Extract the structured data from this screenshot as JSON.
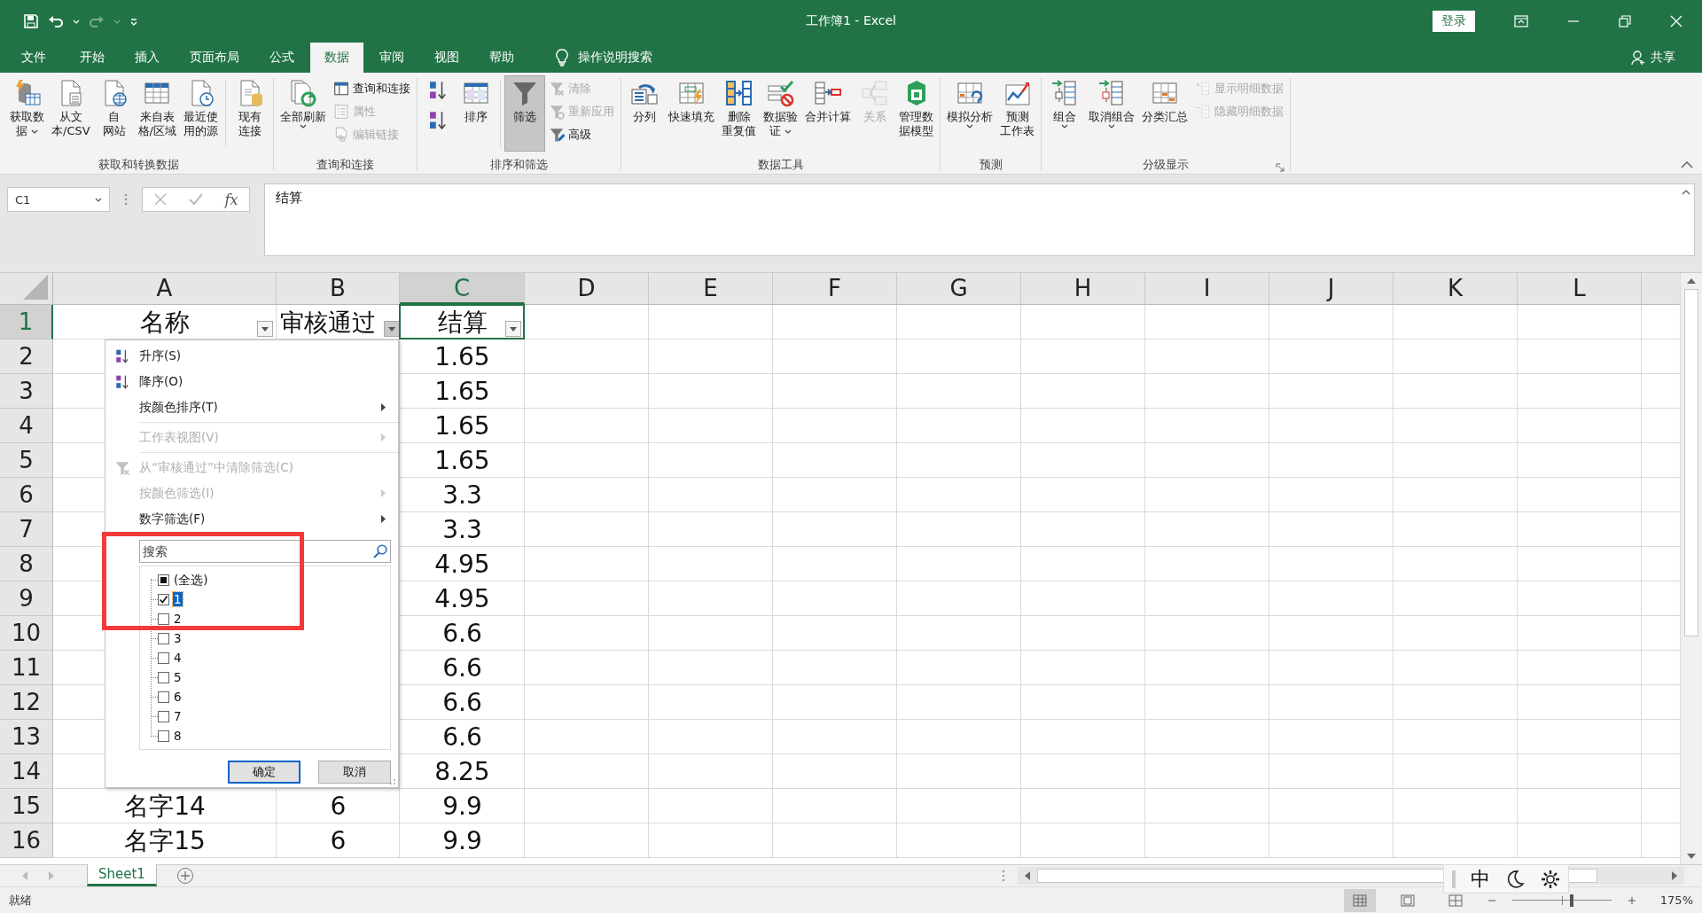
{
  "title_bar": {
    "title": "工作簿1  -  Excel",
    "sign_in": "登录"
  },
  "tabs": [
    {
      "label": "文件",
      "selected": false
    },
    {
      "label": "开始",
      "selected": false
    },
    {
      "label": "插入",
      "selected": false
    },
    {
      "label": "页面布局",
      "selected": false
    },
    {
      "label": "公式",
      "selected": false
    },
    {
      "label": "数据",
      "selected": true
    },
    {
      "label": "审阅",
      "selected": false
    },
    {
      "label": "视图",
      "selected": false
    },
    {
      "label": "帮助",
      "selected": false
    }
  ],
  "tell_me": "操作说明搜索",
  "share": "共享",
  "ribbon": {
    "groups": [
      {
        "label": "获取和转换数据",
        "buttons": [
          {
            "kind": "large",
            "lines": [
              "获取数",
              "据"
            ],
            "dropdown": true,
            "disabled": false,
            "selected": false
          },
          {
            "kind": "large",
            "lines": [
              "从文",
              "本/CSV"
            ],
            "disabled": false,
            "selected": false
          },
          {
            "kind": "large",
            "lines": [
              "自",
              "网站"
            ],
            "disabled": false,
            "selected": false
          },
          {
            "kind": "large",
            "lines": [
              "来自表",
              "格/区域"
            ],
            "disabled": false,
            "selected": false
          },
          {
            "kind": "large",
            "lines": [
              "最近使",
              "用的源"
            ],
            "disabled": false,
            "selected": false
          },
          {
            "kind": "large",
            "lines": [
              "现有",
              "连接"
            ],
            "separated": true,
            "disabled": false,
            "selected": false
          }
        ]
      },
      {
        "label": "查询和连接",
        "buttons": [
          {
            "kind": "large",
            "lines": [
              "全部刷新"
            ],
            "dropdown": true,
            "disabled": false,
            "selected": false
          },
          {
            "kind": "small",
            "lines": [
              "查询和连接"
            ],
            "disabled": false,
            "selected": false
          },
          {
            "kind": "small",
            "lines": [
              "属性"
            ],
            "disabled": true,
            "selected": false
          },
          {
            "kind": "small",
            "lines": [
              "编辑链接"
            ],
            "disabled": true,
            "selected": false
          }
        ]
      },
      {
        "label": "排序和筛选",
        "buttons": [
          {
            "kind": "icon",
            "disabled": false,
            "selected": false
          },
          {
            "kind": "icon",
            "disabled": false,
            "selected": false
          },
          {
            "kind": "large",
            "lines": [
              "排序"
            ],
            "disabled": false,
            "selected": false
          },
          {
            "kind": "large",
            "lines": [
              "筛选"
            ],
            "separated": true,
            "disabled": false,
            "selected": true
          },
          {
            "kind": "small",
            "lines": [
              "清除"
            ],
            "disabled": true,
            "selected": false
          },
          {
            "kind": "small",
            "lines": [
              "重新应用"
            ],
            "disabled": true,
            "selected": false
          },
          {
            "kind": "small",
            "lines": [
              "高级"
            ],
            "disabled": false,
            "selected": false
          }
        ]
      },
      {
        "label": "数据工具",
        "buttons": [
          {
            "kind": "large",
            "lines": [
              "分列"
            ],
            "disabled": false,
            "selected": false
          },
          {
            "kind": "large",
            "lines": [
              "快速填充"
            ],
            "disabled": false,
            "selected": false
          },
          {
            "kind": "large",
            "lines": [
              "删除",
              "重复值"
            ],
            "disabled": false,
            "selected": false
          },
          {
            "kind": "large",
            "lines": [
              "数据验",
              "证"
            ],
            "dropdown": true,
            "disabled": false,
            "selected": false
          },
          {
            "kind": "large",
            "lines": [
              "合并计算"
            ],
            "disabled": false,
            "selected": false
          },
          {
            "kind": "large",
            "lines": [
              "关系"
            ],
            "disabled": true,
            "selected": false
          },
          {
            "kind": "large",
            "lines": [
              "管理数",
              "据模型"
            ],
            "disabled": false,
            "selected": false
          }
        ]
      },
      {
        "label": "预测",
        "buttons": [
          {
            "kind": "large",
            "lines": [
              "模拟分析"
            ],
            "dropdown": true,
            "disabled": false,
            "selected": false
          },
          {
            "kind": "large",
            "lines": [
              "预测",
              "工作表"
            ],
            "disabled": false,
            "selected": false
          }
        ]
      },
      {
        "label": "分级显示",
        "launcher": true,
        "buttons": [
          {
            "kind": "large",
            "lines": [
              "组合"
            ],
            "dropdown": true,
            "disabled": false,
            "selected": false
          },
          {
            "kind": "large",
            "lines": [
              "取消组合"
            ],
            "dropdown": true,
            "disabled": false,
            "selected": false
          },
          {
            "kind": "large",
            "lines": [
              "分类汇总"
            ],
            "disabled": false,
            "selected": false
          },
          {
            "kind": "small",
            "lines": [
              "显示明细数据"
            ],
            "disabled": true,
            "selected": false
          },
          {
            "kind": "small",
            "lines": [
              "隐藏明细数据"
            ],
            "disabled": true,
            "selected": false
          }
        ]
      }
    ]
  },
  "formula_bar": {
    "name_box": "C1",
    "fx": "fx",
    "value": "结算"
  },
  "columns": [
    {
      "label": "A",
      "selected": false
    },
    {
      "label": "B",
      "selected": false
    },
    {
      "label": "C",
      "selected": true
    },
    {
      "label": "D",
      "selected": false
    },
    {
      "label": "E",
      "selected": false
    },
    {
      "label": "F",
      "selected": false
    },
    {
      "label": "G",
      "selected": false
    },
    {
      "label": "H",
      "selected": false
    },
    {
      "label": "I",
      "selected": false
    },
    {
      "label": "J",
      "selected": false
    },
    {
      "label": "K",
      "selected": false
    },
    {
      "label": "L",
      "selected": false
    }
  ],
  "rows": [
    {
      "label": "1",
      "selected": true,
      "a": "名称",
      "b": "审核通过",
      "c": "结算"
    },
    {
      "label": "2",
      "selected": false,
      "c": "1.65"
    },
    {
      "label": "3",
      "selected": false,
      "c": "1.65"
    },
    {
      "label": "4",
      "selected": false,
      "c": "1.65"
    },
    {
      "label": "5",
      "selected": false,
      "c": "1.65"
    },
    {
      "label": "6",
      "selected": false,
      "c": "3.3"
    },
    {
      "label": "7",
      "selected": false,
      "c": "3.3"
    },
    {
      "label": "8",
      "selected": false,
      "c": "4.95"
    },
    {
      "label": "9",
      "selected": false,
      "c": "4.95"
    },
    {
      "label": "10",
      "selected": false,
      "c": "6.6"
    },
    {
      "label": "11",
      "selected": false,
      "c": "6.6"
    },
    {
      "label": "12",
      "selected": false,
      "c": "6.6"
    },
    {
      "label": "13",
      "selected": false,
      "c": "6.6"
    },
    {
      "label": "14",
      "selected": false,
      "c": "8.25"
    },
    {
      "label": "15",
      "selected": false,
      "a": "名字14",
      "b": "6",
      "c": "9.9"
    },
    {
      "label": "16",
      "selected": false,
      "a": "名字15",
      "b": "6",
      "c": "9.9"
    }
  ],
  "header_filters": [
    {
      "selected": false
    },
    {
      "selected": true
    },
    {
      "selected": false
    }
  ],
  "filter_menu": {
    "items": [
      {
        "kind": "sort-asc",
        "label": "升序(S)",
        "disabled": false,
        "submenu": false
      },
      {
        "kind": "sort-desc",
        "label": "降序(O)",
        "disabled": false,
        "submenu": false
      },
      {
        "kind": "plain",
        "label": "按颜色排序(T)",
        "disabled": false,
        "submenu": true
      },
      {
        "kind": "plain",
        "label": "工作表视图(V)",
        "disabled": true,
        "submenu": true,
        "separated": true
      },
      {
        "kind": "clear-filter",
        "label": "从“审核通过”中清除筛选(C)",
        "disabled": true,
        "submenu": false,
        "separated": true
      },
      {
        "kind": "plain",
        "label": "按颜色筛选(I)",
        "disabled": true,
        "submenu": true
      },
      {
        "kind": "plain",
        "label": "数字筛选(F)",
        "disabled": false,
        "submenu": true
      }
    ],
    "search": {
      "placeholder": "搜索"
    },
    "values": [
      {
        "label": "(全选)",
        "checked": false,
        "partial": true,
        "selected": false
      },
      {
        "label": "1",
        "checked": true,
        "partial": false,
        "selected": true
      },
      {
        "label": "2",
        "checked": false,
        "partial": false,
        "selected": false
      },
      {
        "label": "3",
        "checked": false,
        "partial": false,
        "selected": false
      },
      {
        "label": "4",
        "checked": false,
        "partial": false,
        "selected": false
      },
      {
        "label": "5",
        "checked": false,
        "partial": false,
        "selected": false
      },
      {
        "label": "6",
        "checked": false,
        "partial": false,
        "selected": false
      },
      {
        "label": "7",
        "checked": false,
        "partial": false,
        "selected": false
      },
      {
        "label": "8",
        "checked": false,
        "partial": false,
        "selected": false
      }
    ],
    "buttons": [
      {
        "label": "确定",
        "default": true
      },
      {
        "label": "取消",
        "default": false
      }
    ]
  },
  "sheet_tabs": [
    {
      "label": "Sheet1",
      "selected": true
    }
  ],
  "status_bar": {
    "status": "就绪",
    "views": [
      {
        "selected": true
      },
      {
        "selected": false
      },
      {
        "selected": false
      }
    ],
    "zoom": {
      "level": 0.6,
      "reading": "175%"
    }
  },
  "ime_bar": {
    "mode": "中"
  }
}
